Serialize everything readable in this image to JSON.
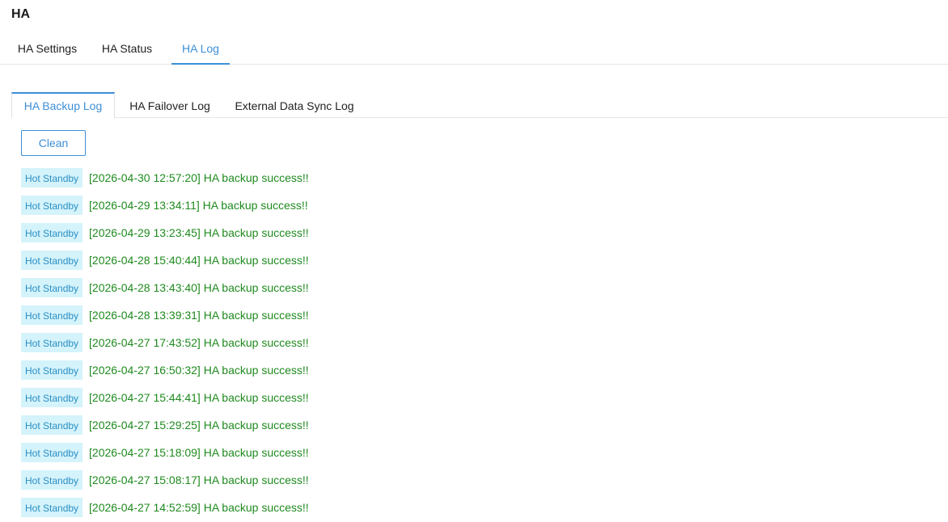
{
  "page": {
    "title": "HA"
  },
  "top_tabs": [
    {
      "label": "HA Settings",
      "active": false
    },
    {
      "label": "HA Status",
      "active": false
    },
    {
      "label": "HA Log",
      "active": true
    }
  ],
  "sub_tabs": [
    {
      "label": "HA Backup Log",
      "active": true
    },
    {
      "label": "HA Failover Log",
      "active": false
    },
    {
      "label": "External Data Sync Log",
      "active": false
    }
  ],
  "actions": {
    "clean_label": "Clean"
  },
  "colors": {
    "accent": "#3d8fd6",
    "success_text": "#1f8a1f",
    "badge_bg": "#d4f3fb",
    "badge_text": "#2b8fc4"
  },
  "logs": [
    {
      "badge": "Hot Standby",
      "message": "[2026-04-30 12:57:20] HA backup success!!"
    },
    {
      "badge": "Hot Standby",
      "message": "[2026-04-29 13:34:11] HA backup success!!"
    },
    {
      "badge": "Hot Standby",
      "message": "[2026-04-29 13:23:45] HA backup success!!"
    },
    {
      "badge": "Hot Standby",
      "message": "[2026-04-28 15:40:44] HA backup success!!"
    },
    {
      "badge": "Hot Standby",
      "message": "[2026-04-28 13:43:40] HA backup success!!"
    },
    {
      "badge": "Hot Standby",
      "message": "[2026-04-28 13:39:31] HA backup success!!"
    },
    {
      "badge": "Hot Standby",
      "message": "[2026-04-27 17:43:52] HA backup success!!"
    },
    {
      "badge": "Hot Standby",
      "message": "[2026-04-27 16:50:32] HA backup success!!"
    },
    {
      "badge": "Hot Standby",
      "message": "[2026-04-27 15:44:41] HA backup success!!"
    },
    {
      "badge": "Hot Standby",
      "message": "[2026-04-27 15:29:25] HA backup success!!"
    },
    {
      "badge": "Hot Standby",
      "message": "[2026-04-27 15:18:09] HA backup success!!"
    },
    {
      "badge": "Hot Standby",
      "message": "[2026-04-27 15:08:17] HA backup success!!"
    },
    {
      "badge": "Hot Standby",
      "message": "[2026-04-27 14:52:59] HA backup success!!"
    }
  ]
}
